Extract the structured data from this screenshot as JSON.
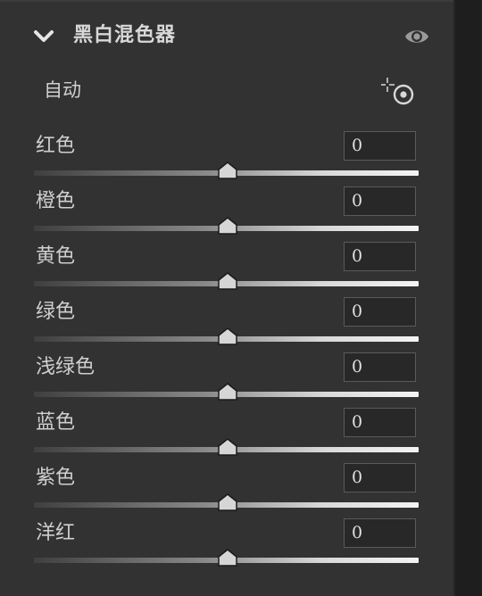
{
  "panel": {
    "title": "黑白混色器",
    "auto_label": "自动"
  },
  "icons": {
    "collapse": "chevron-down-icon",
    "visibility": "eye-icon",
    "targeted_adjustment": "target-adjust-icon",
    "slider_thumb": "triangle-thumb-icon"
  },
  "colors": {
    "panel_bg": "#323232",
    "text": "#cfcfcf",
    "field_bg": "#282828",
    "field_border": "#5a5a5a"
  },
  "sliders": [
    {
      "label": "红色",
      "value": "0",
      "level": 0.5
    },
    {
      "label": "橙色",
      "value": "0",
      "level": 0.5
    },
    {
      "label": "黄色",
      "value": "0",
      "level": 0.5
    },
    {
      "label": "绿色",
      "value": "0",
      "level": 0.5
    },
    {
      "label": "浅绿色",
      "value": "0",
      "level": 0.5
    },
    {
      "label": "蓝色",
      "value": "0",
      "level": 0.5
    },
    {
      "label": "紫色",
      "value": "0",
      "level": 0.5
    },
    {
      "label": "洋红",
      "value": "0",
      "level": 0.5
    }
  ]
}
